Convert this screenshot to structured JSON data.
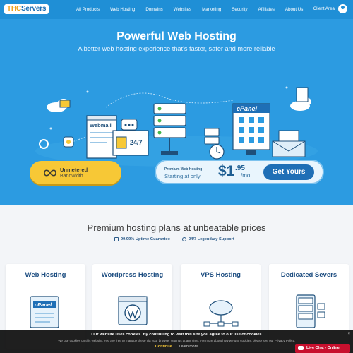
{
  "brand": {
    "logo_main": "THC",
    "logo_rest": "Servers"
  },
  "nav": {
    "items": [
      "All Products",
      "Web Hosting",
      "Domains",
      "Websites",
      "Marketing",
      "Security",
      "Affiliates",
      "About Us"
    ],
    "client_area": "Client Area"
  },
  "hero": {
    "title": "Powerful Web Hosting",
    "subtitle": "A better web hosting experience that's faster, safer and more reliable",
    "illustration_labels": {
      "webmail": "Webmail",
      "support": "24/7",
      "cpanel": "cPanel"
    }
  },
  "cta": {
    "unmetered_line1": "Unmetered",
    "unmetered_line2": "Bandwidth",
    "premium_label": "Premium Web Hosting",
    "starting_text": "Starting at only",
    "price_dollars": "$1",
    "price_cents": ".95",
    "price_period": "/mo.",
    "button": "Get Yours"
  },
  "plans": {
    "title": "Premium hosting plans at unbeatable prices",
    "features": [
      "99.99% Uptime Guarantee",
      "24/7 Legendary Support"
    ],
    "cards": [
      {
        "title": "Web Hosting",
        "icon": "cpanel-server-icon",
        "icon_text": "cPanel"
      },
      {
        "title": "Wordpress Hosting",
        "icon": "wordpress-icon"
      },
      {
        "title": "VPS Hosting",
        "icon": "cloud-network-icon"
      },
      {
        "title": "Dedicated Severs",
        "icon": "server-rack-icon"
      }
    ]
  },
  "cookie": {
    "title": "Our website uses cookies. By continuing to visit this site you agree to our use of cookies",
    "text": "We use cookies on this website. You are free to manage these via your browser settings at any time. For more about how we use cookies, please see our Privacy Policy.",
    "continue": "Continue",
    "learn_more": "Learn more",
    "close": "×"
  },
  "live_chat": {
    "label": "Live Chat - Online"
  },
  "colors": {
    "nav": "#1f8fd6",
    "hero": "#2c9be1",
    "cta_yellow": "#f7c836",
    "button_blue": "#1f6fb6",
    "chat_red": "#c8102e"
  }
}
